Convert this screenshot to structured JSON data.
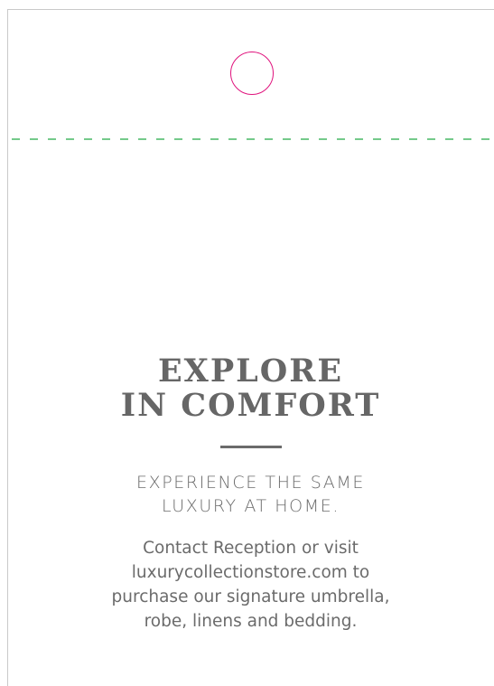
{
  "colors": {
    "hole_outline": "#e0137d",
    "perforation": "#22aa44",
    "text": "#666666"
  },
  "headline": {
    "line1": "EXPLORE",
    "line2": "IN COMFORT"
  },
  "subhead": {
    "line1": "EXPERIENCE THE SAME",
    "line2": "LUXURY AT HOME."
  },
  "body": {
    "line1": "Contact Reception or visit",
    "line2": "luxurycollectionstore.com to",
    "line3": "purchase our signature umbrella,",
    "line4": "robe, linens and bedding."
  }
}
